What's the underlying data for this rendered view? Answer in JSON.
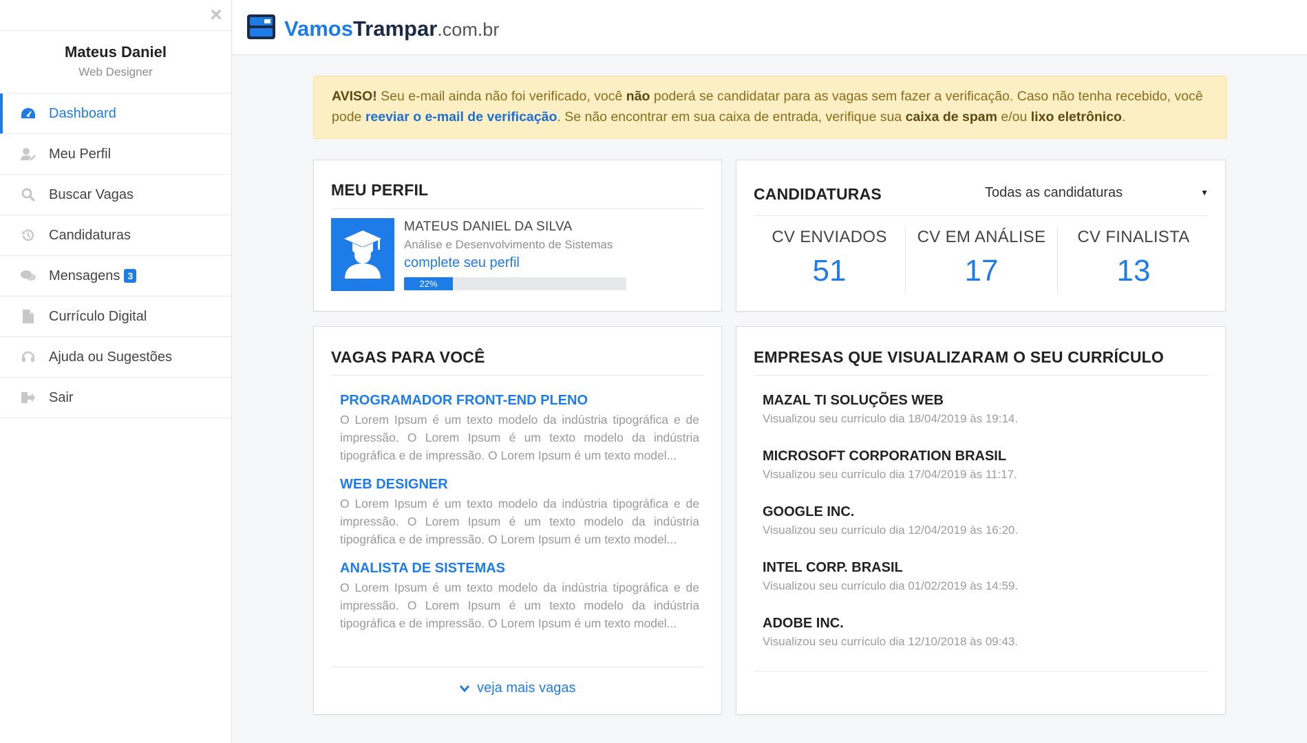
{
  "sidebar": {
    "close_label": "×",
    "user_name": "Mateus Daniel",
    "user_role": "Web Designer",
    "items": [
      {
        "label": "Dashboard",
        "icon": "dashboard-icon",
        "active": true
      },
      {
        "label": "Meu Perfil",
        "icon": "user-edit-icon"
      },
      {
        "label": "Buscar Vagas",
        "icon": "search-icon"
      },
      {
        "label": "Candidaturas",
        "icon": "history-icon"
      },
      {
        "label": "Mensagens",
        "icon": "chat-icon",
        "badge": "3"
      },
      {
        "label": "Currículo Digital",
        "icon": "document-icon"
      },
      {
        "label": "Ajuda ou Sugestões",
        "icon": "headset-icon"
      },
      {
        "label": "Sair",
        "icon": "logout-icon"
      }
    ]
  },
  "header": {
    "logo_part1": "Vamos",
    "logo_part2": "Trampar",
    "logo_part3": ".com.br"
  },
  "alert": {
    "prefix": "AVISO!",
    "text1": " Seu e-mail ainda não foi verificado, você ",
    "bold1": "não",
    "text2": " poderá se candidatar para as vagas sem fazer a verificação. Caso não tenha recebido, você pode ",
    "link": "reeviar o e-mail de verificação",
    "text3": ". Se não encontrar em sua caixa de entrada, verifique sua ",
    "bold2": "caixa de spam",
    "text4": " e/ou ",
    "bold3": "lixo eletrônico",
    "text5": "."
  },
  "perfil": {
    "title": "MEU PERFIL",
    "full_name": "MATEUS DANIEL DA SILVA",
    "course": "Análise e Desenvolvimento de Sistemas",
    "complete_link": "complete seu perfil",
    "progress_label": "22%",
    "progress_value": 22
  },
  "candidaturas": {
    "title": "CANDIDATURAS",
    "filter_value": "Todas as candidaturas",
    "stats": [
      {
        "label": "CV ENVIADOS",
        "value": "51"
      },
      {
        "label": "CV EM ANÁLISE",
        "value": "17"
      },
      {
        "label": "CV FINALISTA",
        "value": "13"
      }
    ]
  },
  "vagas": {
    "title": "VAGAS PARA VOCÊ",
    "items": [
      {
        "title": "PROGRAMADOR FRONT-END PLENO",
        "desc": "O Lorem Ipsum é um texto modelo da indústria tipográfica e de impressão. O Lorem Ipsum é um texto modelo da indústria tipográfica e de impressão. O Lorem Ipsum é um texto model..."
      },
      {
        "title": "WEB DESIGNER",
        "desc": "O Lorem Ipsum é um texto modelo da indústria tipográfica e de impressão. O Lorem Ipsum é um texto modelo da indústria tipográfica e de impressão. O Lorem Ipsum é um texto model..."
      },
      {
        "title": "ANALISTA DE SISTEMAS",
        "desc": "O Lorem Ipsum é um texto modelo da indústria tipográfica e de impressão. O Lorem Ipsum é um texto modelo da indústria tipográfica e de impressão. O Lorem Ipsum é um texto model..."
      }
    ],
    "more_label": "veja mais vagas"
  },
  "empresas": {
    "title": "EMPRESAS QUE VISUALIZARAM O SEU CURRÍCULO",
    "items": [
      {
        "name": "MAZAL TI SOLUÇÕES WEB",
        "viewed": "Visualizou seu currículo dia 18/04/2019 às 19:14."
      },
      {
        "name": "MICROSOFT CORPORATION BRASIL",
        "viewed": "Visualizou seu currículo dia 17/04/2019 às 11:17."
      },
      {
        "name": "GOOGLE INC.",
        "viewed": "Visualizou seu currículo dia 12/04/2019 às 16:20."
      },
      {
        "name": "INTEL CORP. BRASIL",
        "viewed": "Visualizou seu currículo dia 01/02/2019 às 14:59."
      },
      {
        "name": "ADOBE INC.",
        "viewed": "Visualizou seu currículo dia 12/10/2018 às 09:43."
      }
    ]
  },
  "colors": {
    "accent": "#1e7ce8",
    "alert_bg": "#fcefc4",
    "logo_dark": "#1a2a47"
  }
}
